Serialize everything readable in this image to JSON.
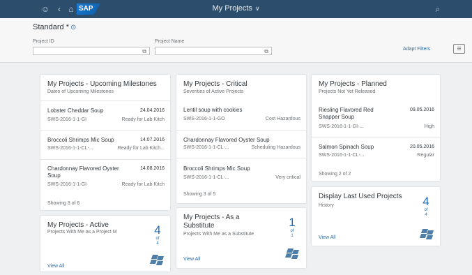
{
  "shell": {
    "title": "My Projects",
    "logo_text": "SAP",
    "icons": [
      "user-icon",
      "back-icon",
      "home-icon",
      "search-icon"
    ]
  },
  "filterbar": {
    "variant": "Standard *",
    "project_id_label": "Project ID",
    "project_name_label": "Project Name",
    "adapt_filters": "Adapt Filters"
  },
  "tiles": {
    "milestones": {
      "title": "My Projects - Upcoming Milestones",
      "subtitle": "Dates of Upcoming Milestones",
      "items": [
        {
          "name": "Lobster Cheddar Soup",
          "value": "24.04.2016",
          "id": "SWS-2016-1-1-GI",
          "status": "Ready for Lab Kitch"
        },
        {
          "name": "Broccoli Shrimps Mic Soup",
          "value": "14.07.2016",
          "id": "SWS-2016-1-1-CL-...",
          "status": "Ready for Lab Kitch..."
        },
        {
          "name": "Chardonnay Flavored Oyster Soup",
          "value": "14.08.2016",
          "id": "SWS-2016-1-1-GI",
          "status": "Ready for Lab Kitch"
        }
      ],
      "footer": "Showing 3 of 6"
    },
    "critical": {
      "title": "My Projects - Critical",
      "subtitle": "Severities of Active Projects",
      "items": [
        {
          "name": "Lentil soup with cookies",
          "id": "SWS-2016-1-1-GO",
          "status": "Cost Hazardous"
        },
        {
          "name": "Chardonnay Flavored Oyster Soup",
          "id": "SWS-2016-1-1-CL-...",
          "status": "Scheduling Hazardous"
        },
        {
          "name": "Broccoli Shrimps Mic Soup",
          "id": "SWS-2016-1-1-CL-...",
          "status": "Very critical"
        }
      ],
      "footer": "Showing 3 of 5"
    },
    "planned": {
      "title": "My Projects - Planned",
      "subtitle": "Projects Not Yet Released",
      "items": [
        {
          "name": "Riesling Flavored Red Snapper Soup",
          "value": "09.05.2016",
          "id": "SWS-2016-1-1-GI-...",
          "status": "High"
        },
        {
          "name": "Salmon Spinach Soup",
          "value": "20.05.2016",
          "id": "SWS-2016-1-1-CL-...",
          "status": "Regular"
        }
      ],
      "footer": "Showing 2 of 2"
    },
    "lastused": {
      "title": "Display Last Used Projects",
      "subtitle": "History",
      "kpi": "4",
      "of_label": "of",
      "of_value": "4",
      "view_all": "View All"
    },
    "active": {
      "title": "My Projects - Active",
      "subtitle": "Projects With Me as a Project M",
      "kpi": "4",
      "of_label": "of",
      "of_value": "4",
      "view_all": "View All"
    },
    "substitute": {
      "title": "My Projects - As a Substitute",
      "subtitle": "Projects With Me as a Substitute",
      "kpi": "1",
      "of_label": "of",
      "of_value": "1",
      "view_all": "View All"
    }
  },
  "colors": {
    "shell": "#2c4e6c",
    "accent": "#1f6fb8",
    "link": "#2a6aa6"
  }
}
